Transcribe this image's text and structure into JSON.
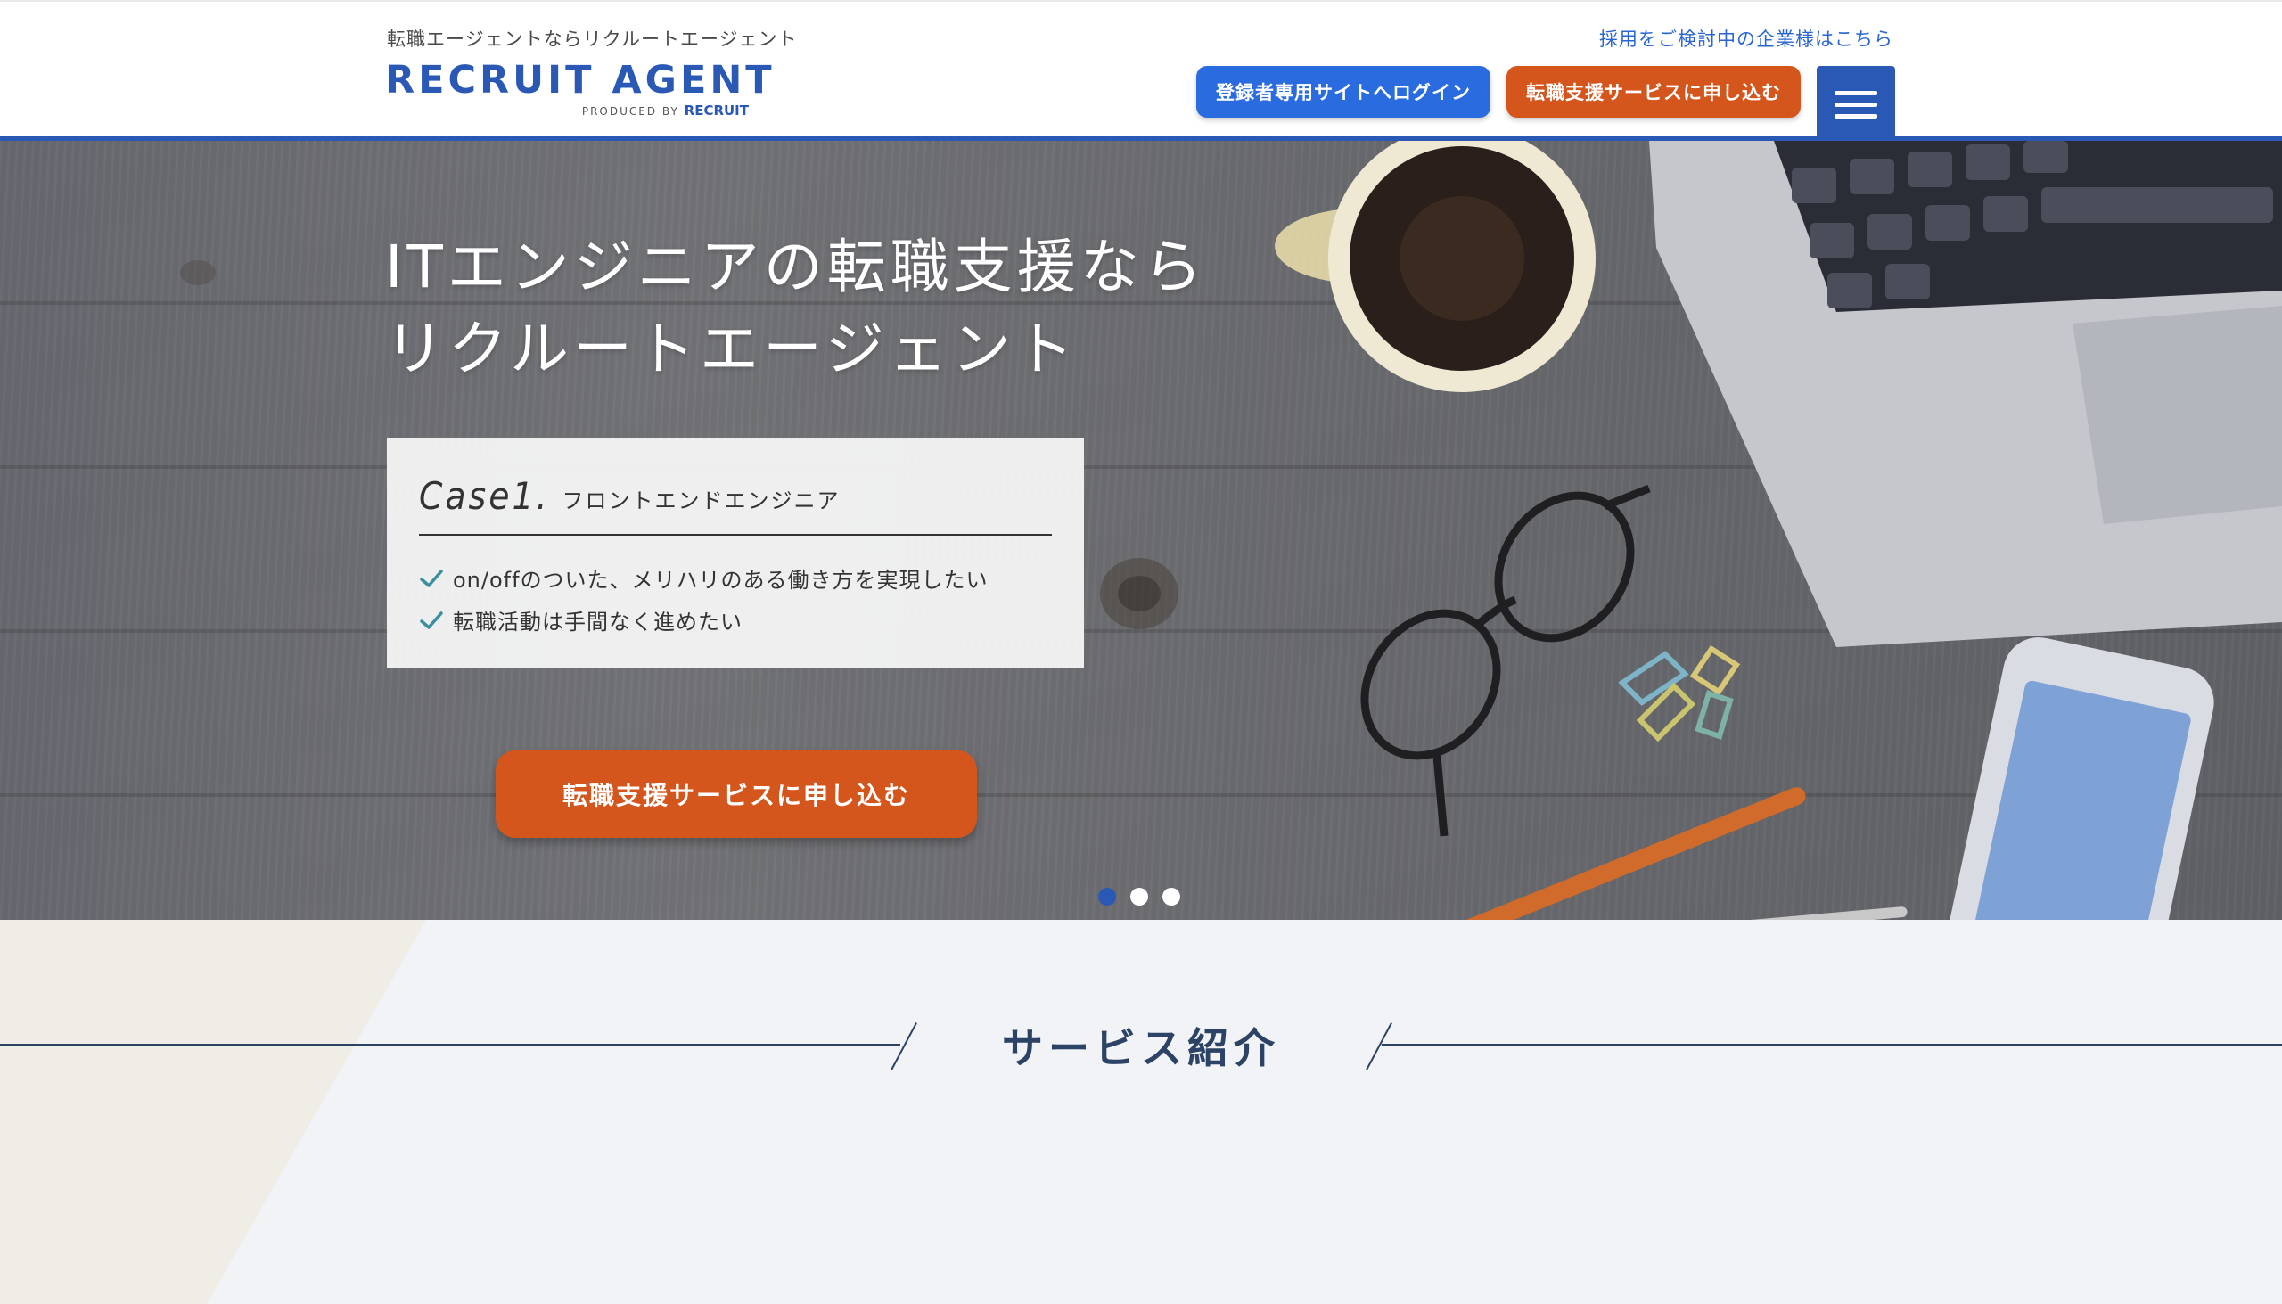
{
  "header": {
    "tagline": "転職エージェントならリクルートエージェント",
    "logo_text": "RECRUIT AGENT",
    "logo_sub_prefix": "PRODUCED BY",
    "logo_sub_brand": "RECRUIT",
    "corp_link": "採用をご検討中の企業様はこちら",
    "login_button": "登録者専用サイトへログイン",
    "apply_button": "転職支援サービスに申し込む",
    "menu_icon": "hamburger-menu-icon"
  },
  "hero": {
    "title_line1": "ITエンジニアの転職支援なら",
    "title_line2": "リクルートエージェント",
    "case": {
      "number": "Case1.",
      "role": "フロントエンドエンジニア",
      "points": [
        "on/offのついた、メリハリのある働き方を実現したい",
        "転職活動は手間なく進めたい"
      ]
    },
    "cta_button": "転職支援サービスに申し込む",
    "slides_total": 3,
    "slide_active": 1
  },
  "services": {
    "title": "サービス紹介"
  },
  "colors": {
    "brand_blue": "#2a58b5",
    "login_blue": "#2b6be0",
    "cta_orange": "#d5561d",
    "link_blue": "#2a66d1",
    "check_teal": "#3a8fa0"
  }
}
